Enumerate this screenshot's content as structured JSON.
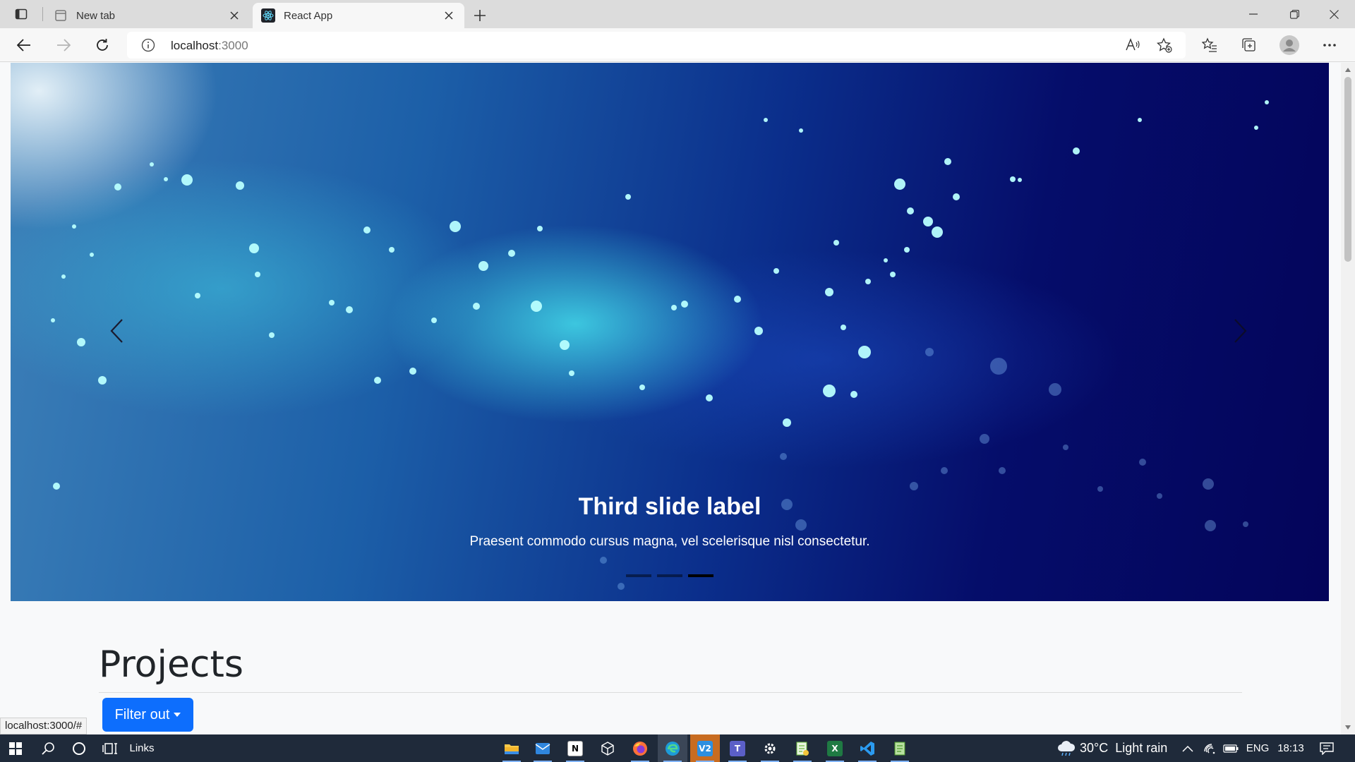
{
  "browser": {
    "tabs": [
      {
        "title": "New tab",
        "active": false
      },
      {
        "title": "React App",
        "active": true
      }
    ],
    "address": {
      "host": "localhost",
      "port": ":3000"
    },
    "status_url": "localhost:3000/#"
  },
  "carousel": {
    "slide_title": "Third slide label",
    "slide_text": "Praesent commodo cursus magna, vel scelerisque nisl consectetur.",
    "slide_count": 3,
    "active_slide": 3
  },
  "projects": {
    "title": "Projects",
    "filter_label": "Filter out"
  },
  "taskbar": {
    "links_label": "Links",
    "weather": {
      "temp": "30°C",
      "desc": "Light rain"
    },
    "language": "ENG",
    "time": "18:13",
    "apps": [
      "file-explorer",
      "mail",
      "notion",
      "3d-viewer",
      "firefox",
      "edge",
      "vscode-insiders",
      "teams",
      "settings",
      "notepad-plus",
      "excel",
      "vscode",
      "notepad"
    ]
  },
  "colors": {
    "primary_button": "#0d6efd",
    "taskbar": "#1f2a3a"
  }
}
